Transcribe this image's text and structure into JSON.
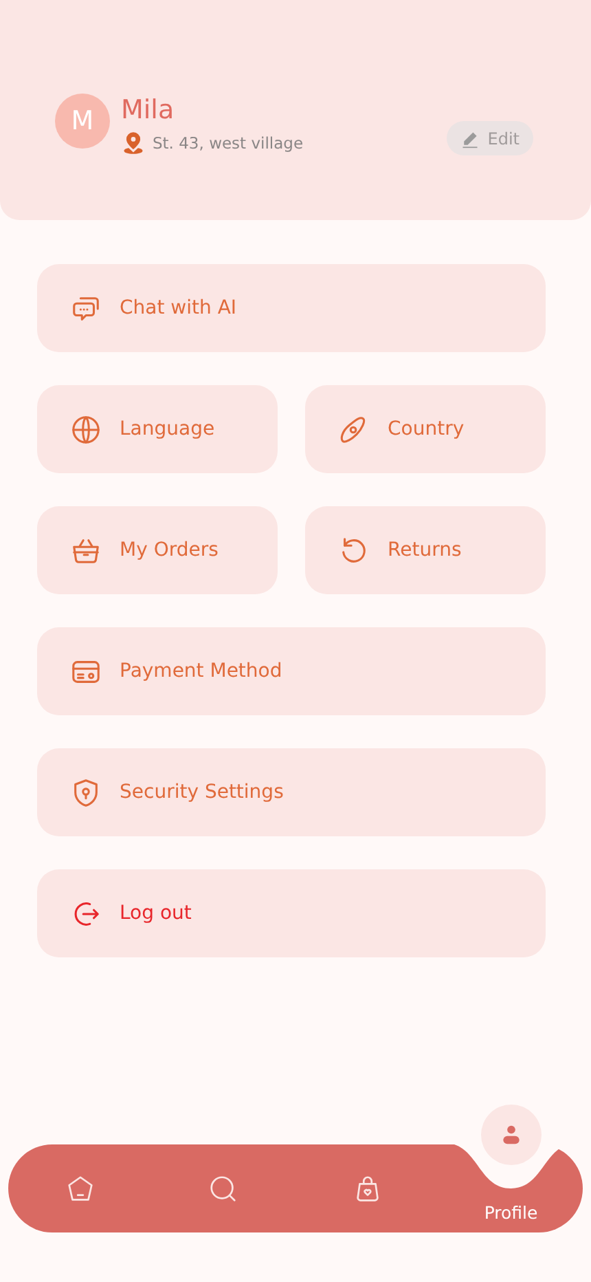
{
  "profile": {
    "initial": "M",
    "name": "Mila",
    "address": "St. 43, west village",
    "edit_button": "Edit"
  },
  "menu_rows": [
    [
      {
        "label": "Chat with AI",
        "kind": "chat",
        "danger": false
      }
    ],
    [
      {
        "label": "Language",
        "kind": "globe",
        "danger": false
      },
      {
        "label": "Country",
        "kind": "compass",
        "danger": false
      }
    ],
    [
      {
        "label": "My Orders",
        "kind": "basket",
        "danger": false
      },
      {
        "label": "Returns",
        "kind": "undo",
        "danger": false
      }
    ],
    [
      {
        "label": "Payment Method",
        "kind": "card",
        "danger": false
      }
    ],
    [
      {
        "label": "Security Settings",
        "kind": "shield",
        "danger": false
      }
    ],
    [
      {
        "label": "Log out",
        "kind": "logout",
        "danger": true
      }
    ]
  ],
  "nav": [
    {
      "kind": "home",
      "selected": false
    },
    {
      "kind": "search",
      "selected": false
    },
    {
      "kind": "bag",
      "selected": false
    },
    {
      "kind": "user",
      "label": "Profile",
      "selected": true
    }
  ]
}
